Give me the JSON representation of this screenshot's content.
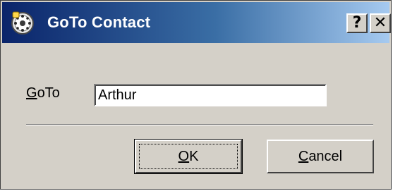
{
  "window": {
    "title": "GoTo Contact",
    "icon": "contact-app-icon",
    "help_button_label": "?",
    "close_button_label": "✕"
  },
  "form": {
    "goto_label_mnemonic": "G",
    "goto_label_rest": "oTo",
    "goto_value": "Arthur"
  },
  "buttons": {
    "ok_mnemonic": "O",
    "ok_rest": "K",
    "cancel_mnemonic": "C",
    "cancel_rest": "ancel"
  },
  "colors": {
    "titlebar_start": "#0a246a",
    "titlebar_end": "#a6caf0",
    "dialog_face": "#d4d0c8"
  }
}
